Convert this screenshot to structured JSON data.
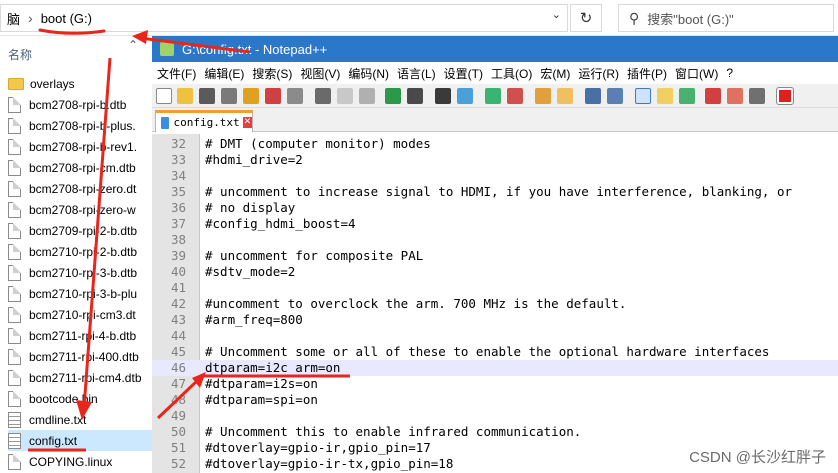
{
  "explorer": {
    "address": {
      "root_glyph": "脑",
      "separator": "›",
      "location": "boot (G:)"
    },
    "refresh_glyph": "↻",
    "search_placeholder": "搜索\"boot (G:)\"",
    "column_header": "名称",
    "files": [
      {
        "name": "overlays",
        "kind": "folder"
      },
      {
        "name": "bcm2708-rpi-b.dtb",
        "kind": "file"
      },
      {
        "name": "bcm2708-rpi-b-plus.",
        "kind": "file"
      },
      {
        "name": "bcm2708-rpi-b-rev1.",
        "kind": "file"
      },
      {
        "name": "bcm2708-rpi-cm.dtb",
        "kind": "file"
      },
      {
        "name": "bcm2708-rpi-zero.dt",
        "kind": "file"
      },
      {
        "name": "bcm2708-rpi-zero-w",
        "kind": "file"
      },
      {
        "name": "bcm2709-rpi-2-b.dtb",
        "kind": "file"
      },
      {
        "name": "bcm2710-rpi-2-b.dtb",
        "kind": "file"
      },
      {
        "name": "bcm2710-rpi-3-b.dtb",
        "kind": "file"
      },
      {
        "name": "bcm2710-rpi-3-b-plu",
        "kind": "file"
      },
      {
        "name": "bcm2710-rpi-cm3.dt",
        "kind": "file"
      },
      {
        "name": "bcm2711-rpi-4-b.dtb",
        "kind": "file"
      },
      {
        "name": "bcm2711-rpi-400.dtb",
        "kind": "file"
      },
      {
        "name": "bcm2711-rpi-cm4.dtb",
        "kind": "file"
      },
      {
        "name": "bootcode.bin",
        "kind": "file"
      },
      {
        "name": "cmdline.txt",
        "kind": "text"
      },
      {
        "name": "config.txt",
        "kind": "text",
        "selected": true
      },
      {
        "name": "COPYING.linux",
        "kind": "file"
      }
    ]
  },
  "notepad": {
    "title": "G:\\config.txt - Notepad++",
    "menu": [
      "文件(F)",
      "编辑(E)",
      "搜索(S)",
      "视图(V)",
      "编码(N)",
      "语言(L)",
      "设置(T)",
      "工具(O)",
      "宏(M)",
      "运行(R)",
      "插件(P)",
      "窗口(W)",
      "?"
    ],
    "tab": {
      "label": "config.txt",
      "close_glyph": "✕"
    },
    "lines": [
      {
        "n": "32",
        "text": "# DMT (computer monitor) modes"
      },
      {
        "n": "33",
        "text": "#hdmi_drive=2"
      },
      {
        "n": "34",
        "text": ""
      },
      {
        "n": "35",
        "text": "# uncomment to increase signal to HDMI, if you have interference, blanking, or"
      },
      {
        "n": "36",
        "text": "# no display"
      },
      {
        "n": "37",
        "text": "#config_hdmi_boost=4"
      },
      {
        "n": "38",
        "text": ""
      },
      {
        "n": "39",
        "text": "# uncomment for composite PAL"
      },
      {
        "n": "40",
        "text": "#sdtv_mode=2"
      },
      {
        "n": "41",
        "text": ""
      },
      {
        "n": "42",
        "text": "#uncomment to overclock the arm. 700 MHz is the default."
      },
      {
        "n": "43",
        "text": "#arm_freq=800"
      },
      {
        "n": "44",
        "text": ""
      },
      {
        "n": "45",
        "text": "# Uncomment some or all of these to enable the optional hardware interfaces"
      },
      {
        "n": "46",
        "text": "dtparam=i2c_arm=on",
        "current": true
      },
      {
        "n": "47",
        "text": "#dtparam=i2s=on"
      },
      {
        "n": "48",
        "text": "#dtparam=spi=on"
      },
      {
        "n": "49",
        "text": ""
      },
      {
        "n": "50",
        "text": "# Uncomment this to enable infrared communication."
      },
      {
        "n": "51",
        "text": "#dtoverlay=gpio-ir,gpio_pin=17"
      },
      {
        "n": "52",
        "text": "#dtoverlay=gpio-ir-tx,gpio_pin=18"
      }
    ]
  },
  "watermark": "CSDN @长沙红胖子",
  "colors": {
    "titlebar": "#2b77c9",
    "annotation": "#e8261c",
    "selected_row": "#cce8ff",
    "current_line": "#e8e8ff"
  }
}
